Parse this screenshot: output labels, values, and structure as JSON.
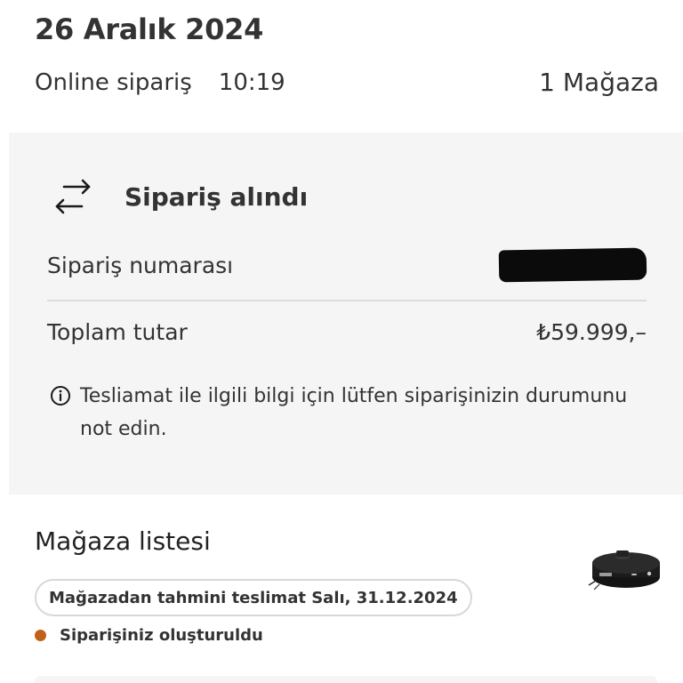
{
  "order": {
    "date": "26 Aralık 2024",
    "type": "Online sipariş",
    "time": "10:19",
    "store_count": "1 Mağaza"
  },
  "status_card": {
    "icon": "swap-arrows-icon",
    "title": "Sipariş alındı",
    "order_number_label": "Sipariş numarası",
    "order_number_value": "",
    "total_label": "Toplam tutar",
    "total_value": "₺59.999,–",
    "notice_icon": "info-icon",
    "notice_text": "Tesliamat ile ilgili bilgi için lütfen siparişinizin durumunu not edin."
  },
  "store_list": {
    "title": "Mağaza listesi",
    "delivery_estimate": "Mağazadan tahmini teslimat Salı, 31.12.2024",
    "order_status": "Siparişiniz oluşturuldu",
    "status_color": "#c0611a",
    "product_image": "robot-vacuum-image"
  }
}
